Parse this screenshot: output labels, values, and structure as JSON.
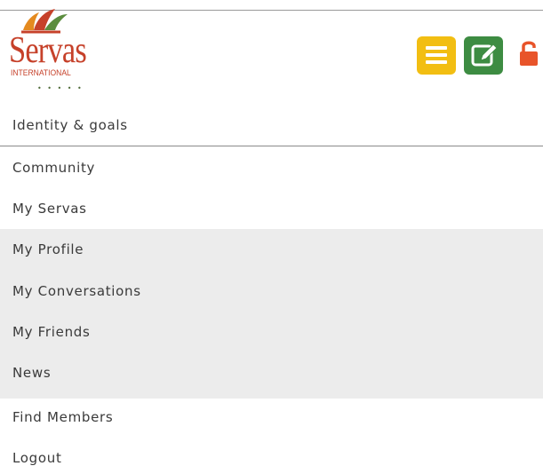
{
  "brand": {
    "name": "Servas",
    "subtitle": "INTERNATIONAL",
    "dots": "• • • • •",
    "color": "#c6412a"
  },
  "header_buttons": {
    "menu": {
      "icon": "hamburger-menu-icon",
      "color": "#f2be12"
    },
    "edit": {
      "icon": "edit-pencil-icon",
      "color": "#3d8c42"
    },
    "lock": {
      "icon": "unlocked-padlock-icon",
      "color": "#e8542a"
    }
  },
  "nav": {
    "items": [
      {
        "label": "Identity & goals"
      },
      {
        "label": "Community"
      },
      {
        "label": "My Servas"
      },
      {
        "label": "My Profile"
      },
      {
        "label": "My Conversations"
      },
      {
        "label": "My Friends"
      },
      {
        "label": "News"
      },
      {
        "label": "Find Members"
      },
      {
        "label": "Logout"
      }
    ]
  }
}
